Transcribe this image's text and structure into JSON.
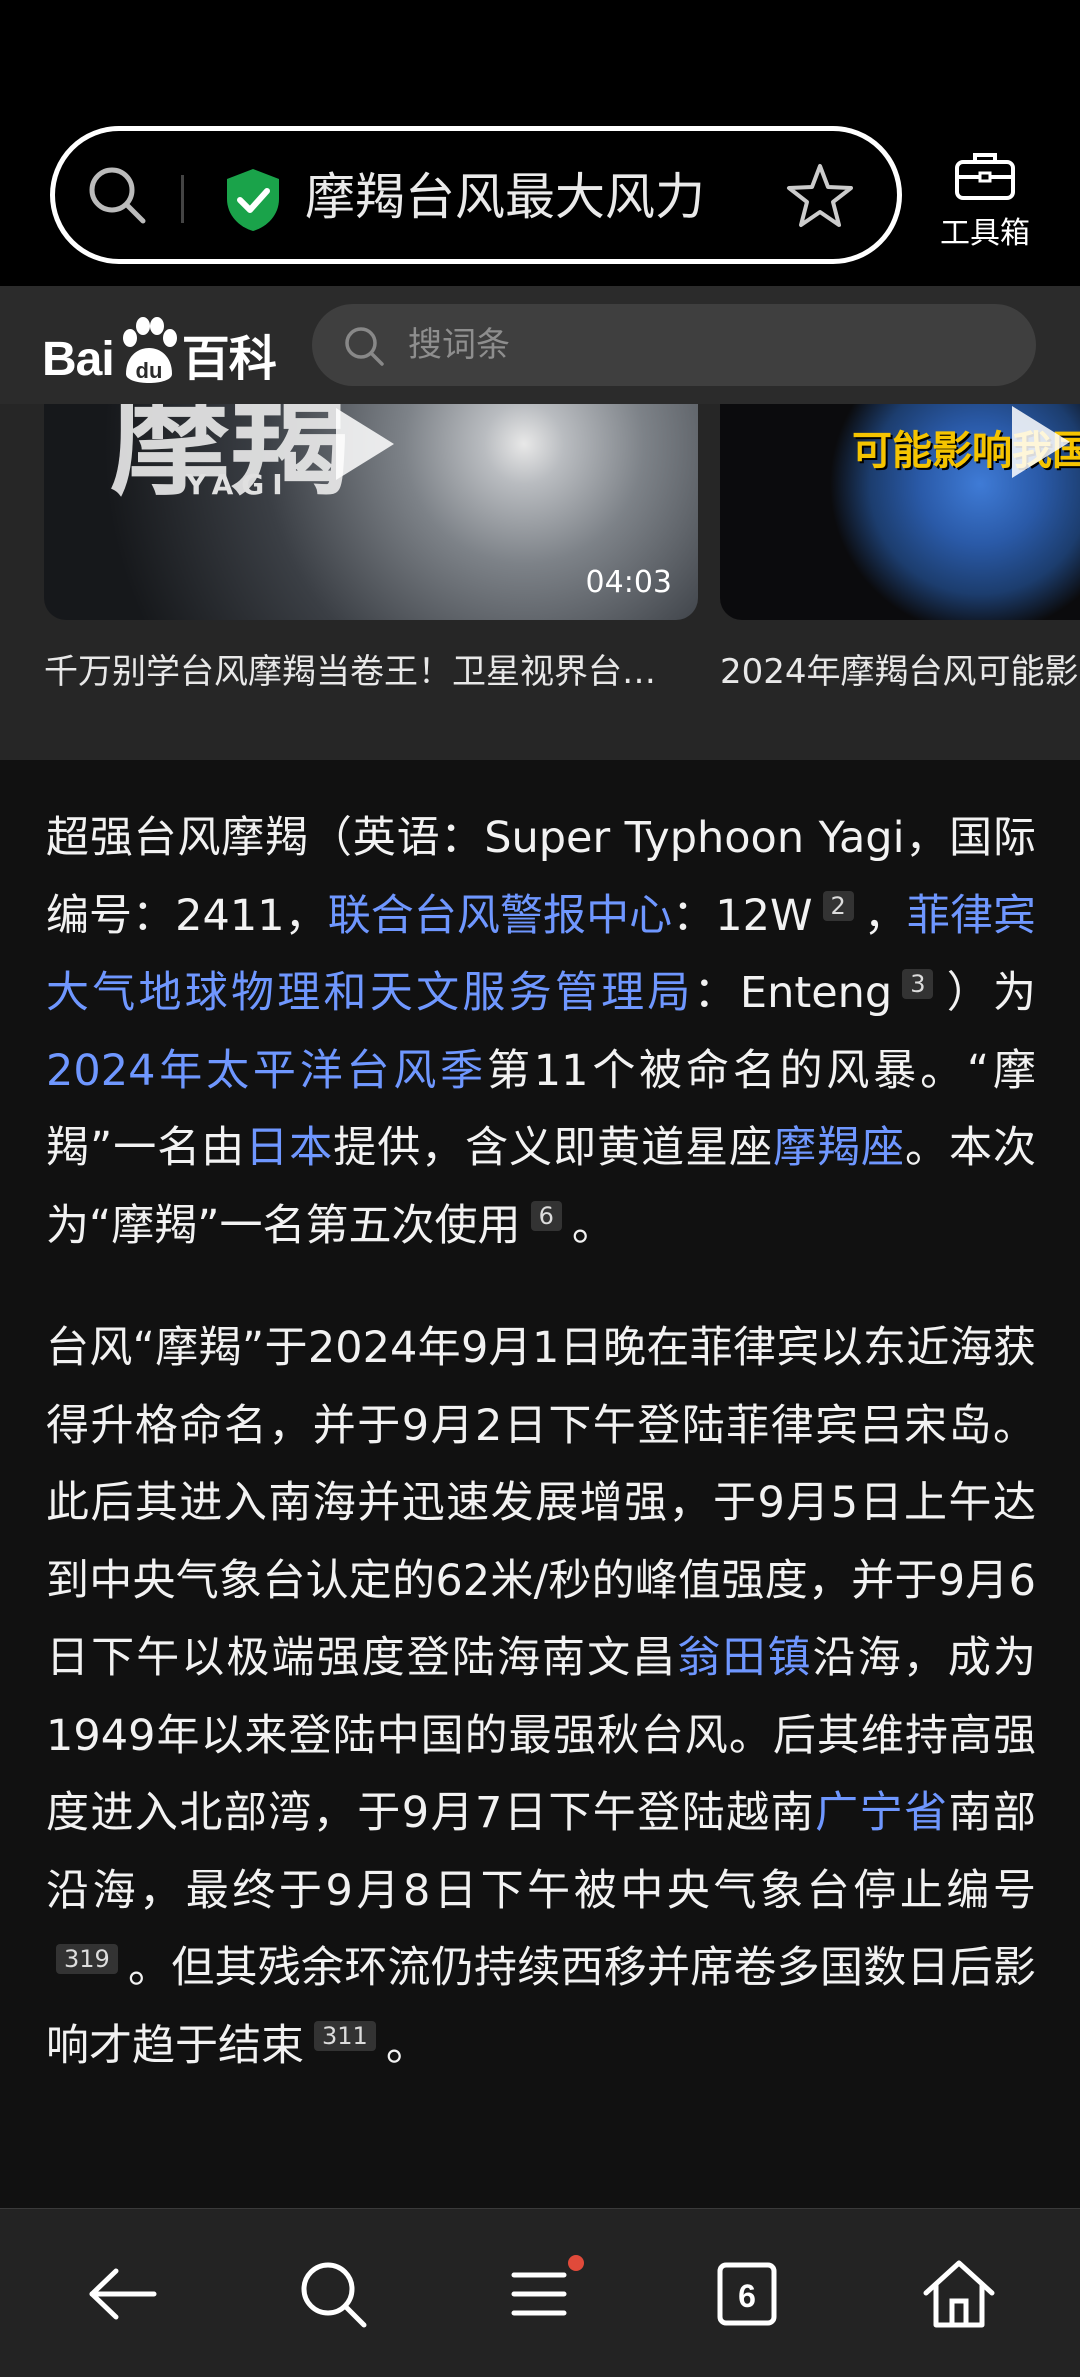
{
  "browser": {
    "query": "摩羯台风最大风力",
    "toolbox_label": "工具箱"
  },
  "baike": {
    "logo_left": "Bai",
    "logo_paw": "du",
    "logo_right": "百科",
    "search_placeholder": "搜词条"
  },
  "videos": [
    {
      "title": "千万别学台风摩羯当卷王！卫星视界台…",
      "duration": "04:03",
      "overlay": "摩羯",
      "sub_overlay": "YAGI"
    },
    {
      "title": "2024年摩羯台风可能影",
      "overlay": "可能影响我国"
    }
  ],
  "article": {
    "p1": [
      {
        "t": "超强台风摩羯（英语：Super Typhoon Yagi，国际编号：2411，"
      },
      {
        "t": "联合台风警报中心",
        "link": true
      },
      {
        "t": "：12W"
      },
      {
        "ref": "2"
      },
      {
        "t": "，"
      },
      {
        "t": "菲律宾大气地球物理和天文服务管理局",
        "link": true
      },
      {
        "t": "：Enteng"
      },
      {
        "ref": "3"
      },
      {
        "t": "）为"
      },
      {
        "t": "2024年太平洋台风季",
        "link": true
      },
      {
        "t": "第11个被命名的风暴。“摩羯”一名由"
      },
      {
        "t": "日本",
        "link": true
      },
      {
        "t": "提供，含义即黄道星座"
      },
      {
        "t": "摩羯座",
        "link": true
      },
      {
        "t": "。本次为“摩羯”一名第五次使用"
      },
      {
        "ref": "6"
      },
      {
        "t": "。"
      }
    ],
    "p2": [
      {
        "t": "台风“摩羯”于2024年9月1日晚在菲律宾以东近海获得升格命名，并于9月2日下午登陆菲律宾吕宋岛。此后其进入南海并迅速发展增强，于9月5日上午达到中央气象台认定的62米/秒的峰值强度，并于9月6日下午以极端强度登陆海南文昌"
      },
      {
        "t": "翁田镇",
        "link": true
      },
      {
        "t": "沿海，成为1949年以来登陆中国的最强秋台风。后其维持高强度进入北部湾，于9月7日下午登陆越南"
      },
      {
        "t": "广宁省",
        "link": true
      },
      {
        "t": "南部沿海，最终于9月8日下午被中央气象台停止编号"
      },
      {
        "ref": "319"
      },
      {
        "t": "。但其残余环流仍持续西移并席卷多国数日后影响才趋于结束"
      },
      {
        "ref": "311"
      },
      {
        "t": "。"
      }
    ]
  },
  "nav": {
    "tabs_count": "6",
    "colors": {
      "notify_dot": "#e04a3a",
      "link": "#6f97ff"
    },
    "icons": [
      "back-arrow-icon",
      "search-icon",
      "menu-icon",
      "tabs-icon",
      "home-icon"
    ]
  }
}
